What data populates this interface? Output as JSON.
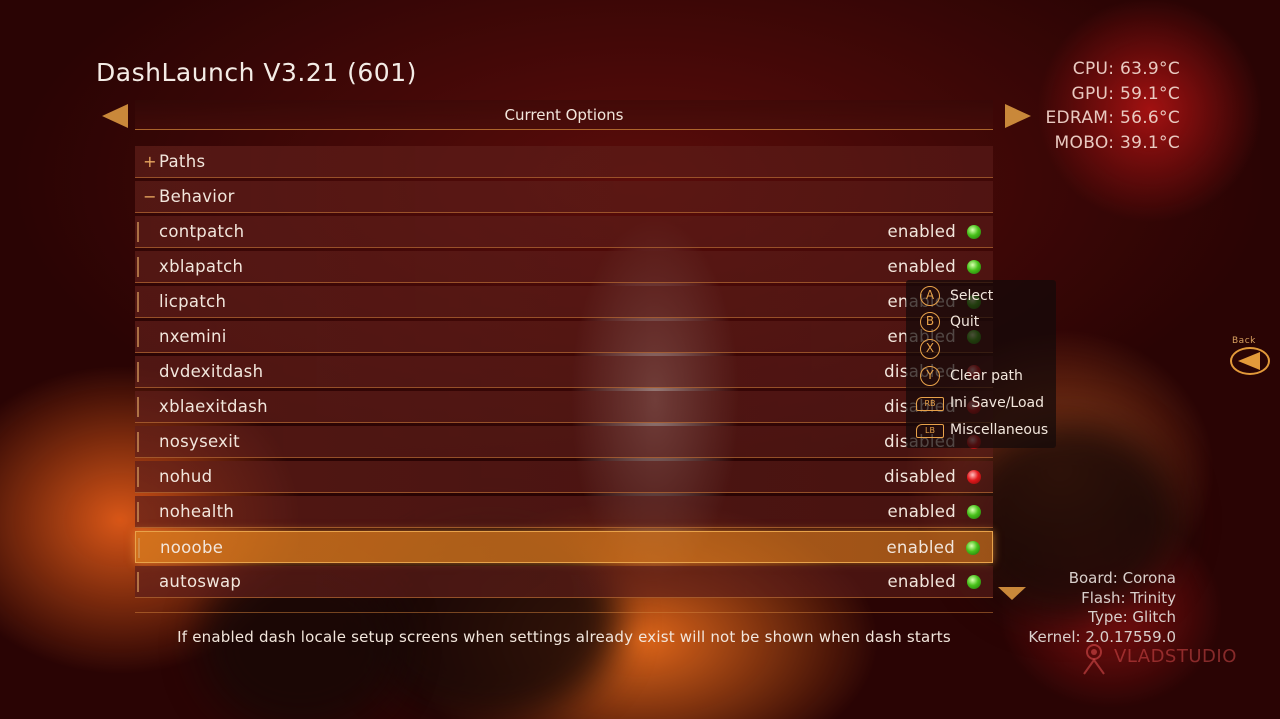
{
  "app": {
    "title": "DashLaunch V3.21 (601)"
  },
  "temps": [
    "CPU: 63.9°C",
    "GPU: 59.1°C",
    "EDRAM: 56.6°C",
    "MOBO: 39.1°C"
  ],
  "header": {
    "title": "Current Options"
  },
  "list": {
    "groups": [
      {
        "sign": "+",
        "label": "Paths"
      },
      {
        "sign": "−",
        "label": "Behavior"
      }
    ],
    "options": [
      {
        "label": "contpatch",
        "value": "enabled",
        "status": "green"
      },
      {
        "label": "xblapatch",
        "value": "enabled",
        "status": "green"
      },
      {
        "label": "licpatch",
        "value": "enabled",
        "status": "green"
      },
      {
        "label": "nxemini",
        "value": "enabled",
        "status": "green"
      },
      {
        "label": "dvdexitdash",
        "value": "disabled",
        "status": "red"
      },
      {
        "label": "xblaexitdash",
        "value": "disabled",
        "status": "red"
      },
      {
        "label": "nosysexit",
        "value": "disabled",
        "status": "red"
      },
      {
        "label": "nohud",
        "value": "disabled",
        "status": "red"
      },
      {
        "label": "nohealth",
        "value": "enabled",
        "status": "green"
      },
      {
        "label": "nooobe",
        "value": "enabled",
        "status": "green",
        "selected": true
      },
      {
        "label": "autoswap",
        "value": "enabled",
        "status": "green"
      }
    ]
  },
  "description": "If enabled dash locale setup screens when settings already exist will not be shown when dash starts",
  "buttons": [
    {
      "key": "A",
      "label": "Select"
    },
    {
      "key": "B",
      "label": "Quit"
    },
    {
      "key": "X",
      "label": ""
    },
    {
      "key": "Y",
      "label": "Clear path"
    },
    {
      "key": "RB",
      "label": "Ini Save/Load"
    },
    {
      "key": "LB",
      "label": "Miscellaneous"
    }
  ],
  "back": {
    "label": "Back"
  },
  "sysinfo": [
    "Board: Corona",
    "Flash: Trinity",
    "Type: Glitch",
    "Kernel: 2.0.17559.0"
  ],
  "watermark": {
    "text": "VLADSTUDIO"
  },
  "colors": {
    "accent": "#e8a24a",
    "enabled_led": "#47c21a",
    "disabled_led": "#e3191c",
    "selected_row": "#d7781e"
  }
}
